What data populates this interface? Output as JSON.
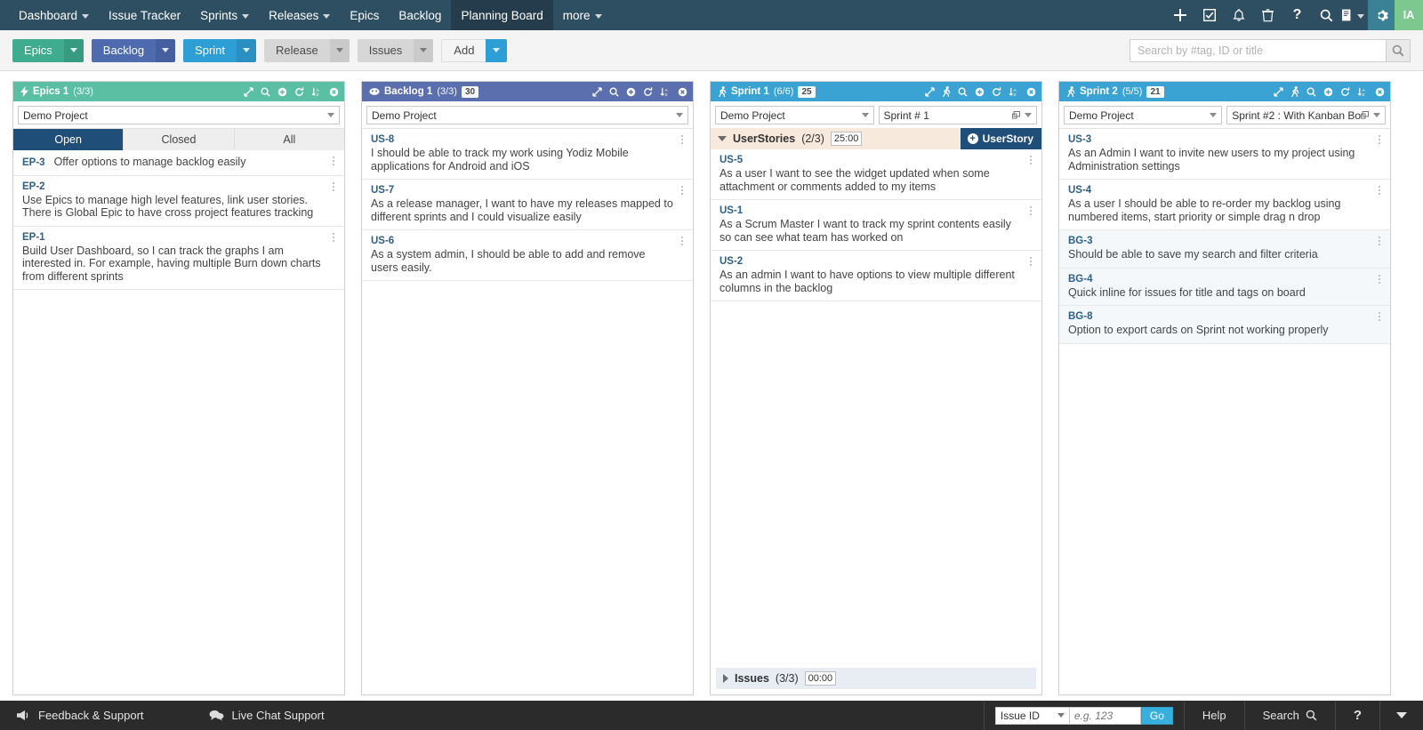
{
  "topnav": {
    "items": [
      {
        "label": "Dashboard",
        "caret": true,
        "active": false
      },
      {
        "label": "Issue Tracker",
        "caret": false,
        "active": false
      },
      {
        "label": "Sprints",
        "caret": true,
        "active": false
      },
      {
        "label": "Releases",
        "caret": true,
        "active": false
      },
      {
        "label": "Epics",
        "caret": false,
        "active": false
      },
      {
        "label": "Backlog",
        "caret": false,
        "active": false
      },
      {
        "label": "Planning Board",
        "caret": false,
        "active": true
      },
      {
        "label": "more",
        "caret": true,
        "active": false
      }
    ],
    "icons": [
      "plus-icon",
      "checkbox-icon",
      "bell-icon",
      "trash-icon",
      "question-icon",
      "search-icon",
      "report-icon"
    ],
    "gear_icon": "gear-icon",
    "avatar_initials": "IA",
    "colors": {
      "bar": "#2e4e61",
      "active_tab": "#243c4b",
      "gear_bg": "#3a8196",
      "avatar_bg": "#7dc88f"
    }
  },
  "toolbar": {
    "buttons": [
      {
        "label": "Epics",
        "color": "#3fab8f"
      },
      {
        "label": "Backlog",
        "color": "#4f6bb0"
      },
      {
        "label": "Sprint",
        "color": "#2e9fd4"
      },
      {
        "label": "Release",
        "color": "#d6d6d6"
      },
      {
        "label": "Issues",
        "color": "#d6d6d6"
      },
      {
        "label": "Add",
        "color": "#f4f4f4"
      }
    ],
    "search_placeholder": "Search by #tag, ID or title",
    "search_value": ""
  },
  "panels": {
    "epics": {
      "title": "Epics 1",
      "count": "(3/3)",
      "icon": "lightning-icon",
      "header_color": "#5bbfa3",
      "tools": [
        "expand-icon",
        "search-icon",
        "add-icon",
        "refresh-icon",
        "sort-icon",
        "close-icon"
      ],
      "project": "Demo Project",
      "tabs": [
        {
          "label": "Open",
          "active": true
        },
        {
          "label": "Closed",
          "active": false
        },
        {
          "label": "All",
          "active": false
        }
      ],
      "cards": [
        {
          "id": "EP-3",
          "text": "Offer options to manage backlog easily",
          "inline": true
        },
        {
          "id": "EP-2",
          "text": "Use Epics to manage high level features, link user stories. There is Global Epic to have cross project features tracking",
          "inline": false
        },
        {
          "id": "EP-1",
          "text": "Build User Dashboard, so I can track the graphs I am interested in. For example, having multiple Burn down charts from different sprints",
          "inline": false
        }
      ]
    },
    "backlog": {
      "title": "Backlog 1",
      "count": "(3/3)",
      "badge": "30",
      "icon": "backlog-icon",
      "header_color": "#5b6fae",
      "tools": [
        "expand-icon",
        "search-icon",
        "add-icon",
        "refresh-icon",
        "sort-icon",
        "close-icon"
      ],
      "project": "Demo Project",
      "cards": [
        {
          "id": "US-8",
          "text": "I should be able to track my work using Yodiz Mobile applications for Android and iOS"
        },
        {
          "id": "US-7",
          "text": "As a release manager, I want to have my releases mapped to different sprints and I could visualize easily"
        },
        {
          "id": "US-6",
          "text": "As a system admin, I should be able to add and remove users easily."
        }
      ]
    },
    "sprint1": {
      "title": "Sprint 1",
      "count": "(6/6)",
      "badge": "25",
      "icon": "runner-icon",
      "header_color": "#3aa3d4",
      "tools": [
        "expand-icon",
        "runner-icon",
        "search-icon",
        "add-icon",
        "refresh-icon",
        "sort-icon",
        "close-icon"
      ],
      "project": "Demo Project",
      "sprint": "Sprint # 1",
      "group": {
        "name": "UserStories",
        "count": "(2/3)",
        "time": "25:00",
        "add_label": "UserStory"
      },
      "cards": [
        {
          "id": "US-5",
          "text": "As a user I want to see the widget updated when some attachment or comments added to my items"
        },
        {
          "id": "US-1",
          "text": "As a Scrum Master I want to track my sprint contents easily so can see what team has worked on"
        },
        {
          "id": "US-2",
          "text": "As an admin I want to have options to view multiple different columns in the backlog"
        }
      ],
      "issues_group": {
        "name": "Issues",
        "count": "(3/3)",
        "time": "00:00"
      }
    },
    "sprint2": {
      "title": "Sprint 2",
      "count": "(5/5)",
      "badge": "21",
      "icon": "runner-icon",
      "header_color": "#3aa3d4",
      "tools": [
        "expand-icon",
        "runner-icon",
        "search-icon",
        "add-icon",
        "refresh-icon",
        "sort-icon",
        "close-icon"
      ],
      "project": "Demo Project",
      "sprint": "Sprint #2 : With Kanban Bo",
      "cards": [
        {
          "id": "US-3",
          "text": "As an Admin I want to invite new users to my project using Administration settings",
          "tint": false
        },
        {
          "id": "US-4",
          "text": "As a user I should be able to re-order my backlog using numbered items, start priority or simple drag n drop",
          "tint": false
        },
        {
          "id": "BG-3",
          "text": "Should be able to save my search and filter criteria",
          "tint": true
        },
        {
          "id": "BG-4",
          "text": "Quick inline for issues for title and tags on board",
          "tint": true
        },
        {
          "id": "BG-8",
          "text": "Option to export cards on Sprint not working properly",
          "tint": true
        }
      ]
    }
  },
  "bottombar": {
    "feedback_label": "Feedback & Support",
    "chat_label": "Live Chat Support",
    "issue_select": "Issue ID",
    "issue_placeholder": "e.g. 123",
    "go_label": "Go",
    "help_label": "Help",
    "search_label": "Search",
    "question_label": "?"
  }
}
